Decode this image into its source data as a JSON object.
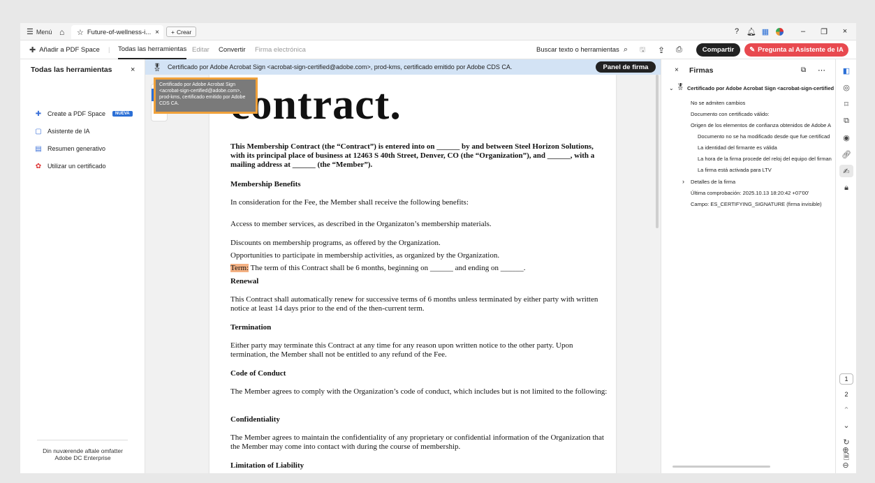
{
  "titlebar": {
    "menu_label": "Menú",
    "tab_title": "Future-of-wellness-i...",
    "new_label": "Crear"
  },
  "toolbar": {
    "add_pdf_space": "Añadir a PDF Space",
    "all_tools": "Todas las herramientas",
    "edit": "Editar",
    "convert": "Convertir",
    "esign": "Firma electrónica",
    "search_tools": "Buscar texto o herramientas",
    "share": "Compartir",
    "ask_ai": "Pregunta al Asistente de IA"
  },
  "left_panel": {
    "title": "Todas las herramientas",
    "items": [
      {
        "label": "Create a PDF Space",
        "badge": "NUEVA"
      },
      {
        "label": "Asistente de IA"
      },
      {
        "label": "Resumen generativo"
      },
      {
        "label": "Utilizar un certificado"
      }
    ],
    "footer_line1": "Din nuværende aftale omfatter",
    "footer_line2": "Adobe DC Enterprise"
  },
  "certbar": {
    "text": "Certificado por Adobe Acrobat Sign <acrobat-sign-certified@adobe.com>, prod-kms, certificado emitido por Adobe CDS CA.",
    "panel_button": "Panel de firma"
  },
  "tooltip": {
    "text": "Certificado por Adobe Acrobat Sign <acrobat-sign-certified@adobe.com>, prod-kms, certificado emitido por Adobe CDS CA."
  },
  "document": {
    "title": "contract.",
    "intro": "This Membership Contract (the “Contract”) is entered into on ______ by and between Steel Horizon Solutions, with its principal place of business at 12463 S 40th Street, Denver, CO (the “Organization”), and ______, with a mailing address at ______ (the “Member”).",
    "h_benefits": "Membership Benefits",
    "benefits_intro": "In consideration for the Fee, the Member shall receive the following benefits:",
    "benefit1": "Access to member services, as described in the Organizaton’s membership materials.",
    "benefit2": "Discounts on membership programs, as offered by the Organization.",
    "benefit3": "Opportunities to participate in membership activities, as organized by the Organization.",
    "term_label": "Term:",
    "term_text": " The term of this Contract shall be 6 months, beginning on ______ and ending on ______.",
    "h_renewal": "Renewal",
    "renewal": "This Contract shall automatically renew for successive terms of 6 months unless terminated by either party with written notice at least 14 days prior to the end of the then-current term.",
    "h_termination": "Termination",
    "termination": "Either party may terminate this Contract at any time for any reason upon written notice to the other party. Upon termination, the Member shall not be entitled to any refund of the Fee.",
    "h_conduct": "Code of Conduct",
    "conduct": "The Member agrees to comply with the Organization’s code of conduct, which includes but is not limited to the following:",
    "h_confidentiality": "Confidentiality",
    "confidentiality": "The Member agrees to maintain the confidentiality of any proprietary or confidential information of the Organization that the Member may come into contact with during the course of membership.",
    "h_liability": "Limitation of Liability"
  },
  "right_panel": {
    "title": "Firmas",
    "cert_title": "Certificado por Adobe Acrobat Sign <acrobat-sign-certified@",
    "lines": [
      "No se admiten cambios",
      "Documento con certificado válido:",
      "Origen de los elementos de confianza obtenidos de Adobe A"
    ],
    "sub_lines": [
      "Documento no se ha modificado desde que fue certificad",
      "La identidad del firmante es válida",
      "La hora de la firma procede del reloj del equipo del firman",
      "La firma está activada para LTV"
    ],
    "details": "Detalles de la firma",
    "last_check": "Última comprobación: 2025.10.13 18:20:42 +07'00'",
    "field": "Campo: ES_CERTIFYING_SIGNATURE (firma invisible)"
  },
  "pager": {
    "page1": "1",
    "page2": "2"
  }
}
